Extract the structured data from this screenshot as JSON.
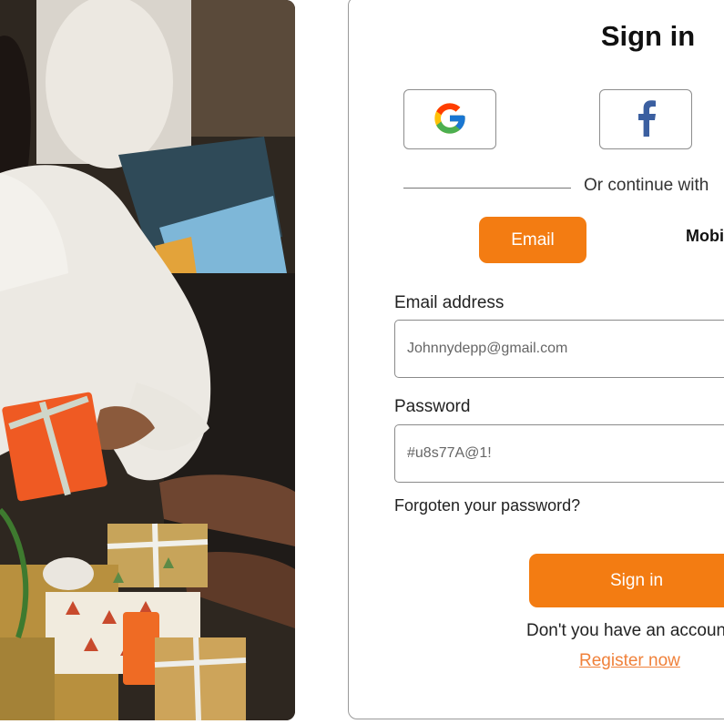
{
  "page": {
    "title": "Sign in",
    "accent_color": "#f37c12"
  },
  "social": {
    "google_icon": "google-icon",
    "facebook_icon": "facebook-icon"
  },
  "divider": {
    "text": "Or continue with"
  },
  "tabs": {
    "email_label": "Email",
    "mobile_label": "Mobile",
    "active": "Email"
  },
  "form": {
    "email_label": "Email address",
    "email_placeholder": "Johnnydepp@gmail.com",
    "password_label": "Password",
    "password_placeholder": "#u8s77A@1!",
    "forgot_text": "Forgoten your password?",
    "submit_label": "Sign in"
  },
  "footer": {
    "no_account_text": "Don't you have an account?",
    "register_text": "Register now"
  }
}
